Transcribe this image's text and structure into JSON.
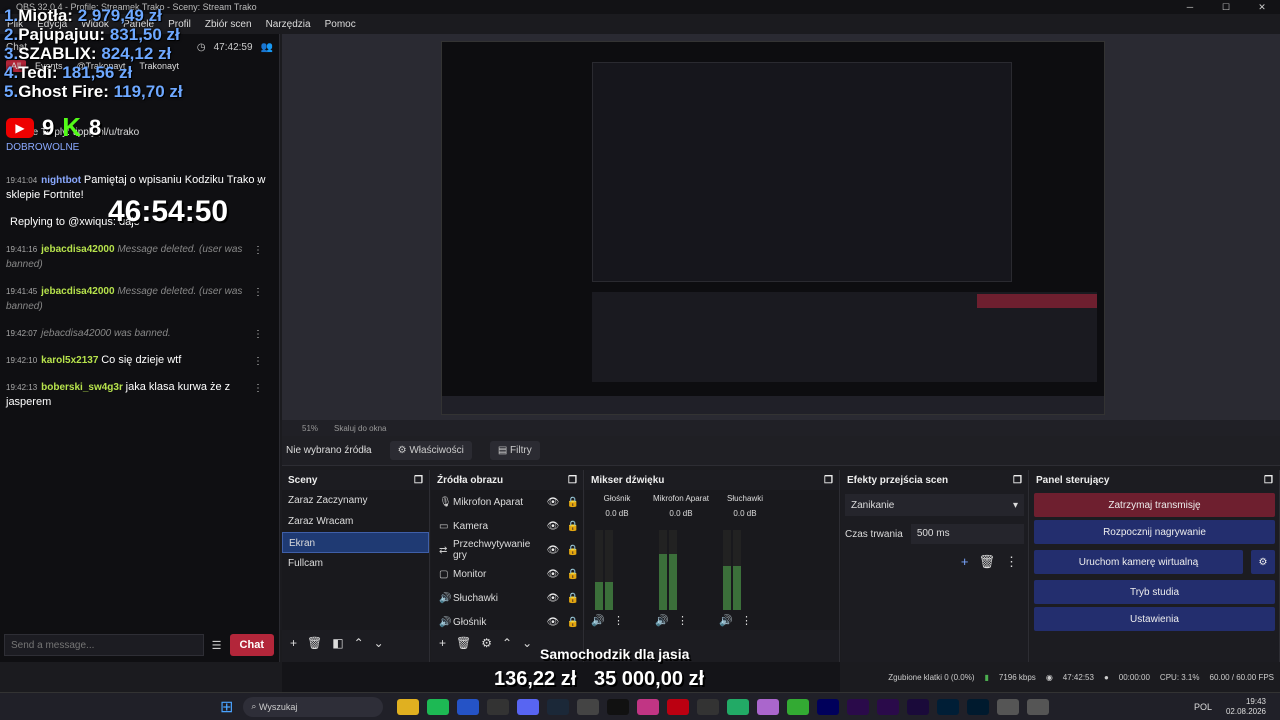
{
  "window": {
    "title": "OBS 32.0.4 - Profile: Streamek Trako - Sceny: Stream Trako",
    "controls": [
      "─",
      "☐",
      "✕"
    ]
  },
  "menu": [
    "Plik",
    "Edycja",
    "Widok",
    "Panele",
    "Profil",
    "Zbiór scen",
    "Narzędzia",
    "Pomoc"
  ],
  "overlay": {
    "donors": [
      {
        "num": "1.",
        "name": "Miotła:",
        "amount": "2 979,49 zł"
      },
      {
        "num": "2.",
        "name": "Pajupajuu:",
        "amount": "831,50 zł"
      },
      {
        "num": "3.",
        "name": "SZABLIX:",
        "amount": "824,12 zł"
      },
      {
        "num": "4.",
        "name": "Tedi:",
        "amount": "181,56 zł"
      },
      {
        "num": "5.",
        "name": "Ghost Fire:",
        "amount": "119,70 zł"
      }
    ],
    "yt_count": "9",
    "kick_count": "8",
    "timer": "46:54:50",
    "bottom_title": "Samochodzik dla jasia",
    "bottom_money_1": "136,22 zł",
    "bottom_money_2": "35 000,00 zł"
  },
  "chat": {
    "header_label": "Chat",
    "clock": "47:42:59",
    "tabs": [
      "All",
      "Events",
      "@Trakonayt",
      "Trakonayt"
    ],
    "donate_line": "Donate Tipply: tipply.pl/u/trako",
    "donate_line2": "DOBROWOLNE",
    "messages": [
      {
        "time": "19:41:04",
        "user": "nightbot",
        "text": "Pamiętaj o wpisaniu Kodziku Trako w sklepie Fortnite!",
        "type": "blue"
      },
      {
        "time": "",
        "user": "",
        "text": "Replying to @xwiqus: daje",
        "type": "reply"
      },
      {
        "time": "19:41:16",
        "user": "jebacdisa42000",
        "text": "Message deleted. (user was banned)",
        "type": "deleted"
      },
      {
        "time": "19:41:45",
        "user": "jebacdisa42000",
        "text": "Message deleted. (user was banned)",
        "type": "deleted"
      },
      {
        "time": "19:42:07",
        "user": "",
        "text": "jebacdisa42000 was banned.",
        "type": "ban"
      },
      {
        "time": "19:42:10",
        "user": "karol5x2137",
        "text": "Co się dzieje wtf",
        "type": "white"
      },
      {
        "time": "19:42:13",
        "user": "boberski_sw4g3r",
        "text": "jaka klasa kurwa że z jasperem",
        "type": "green"
      }
    ],
    "input_placeholder": "Send a message...",
    "send_label": "Chat"
  },
  "preview": {
    "zoom": "51%",
    "fit_label": "Skaluj do okna"
  },
  "source_bar": {
    "label": "Nie wybrano źródła",
    "props": "Właściwości",
    "filters": "Filtry"
  },
  "scenes": {
    "title": "Sceny",
    "items": [
      "Zaraz Zaczynamy",
      "Zaraz Wracam",
      "Ekran",
      "Fullcam"
    ],
    "selected": 2
  },
  "sources": {
    "title": "Źródła obrazu",
    "items": [
      {
        "icon": "microphone-icon",
        "glyph": "🎙",
        "name": "Mikrofon Aparat"
      },
      {
        "icon": "camera-icon",
        "glyph": "▭",
        "name": "Kamera"
      },
      {
        "icon": "capture-icon",
        "glyph": "⇄",
        "name": "Przechwytywanie gry"
      },
      {
        "icon": "monitor-icon",
        "glyph": "▢",
        "name": "Monitor"
      },
      {
        "icon": "speaker-icon",
        "glyph": "🔊",
        "name": "Słuchawki"
      },
      {
        "icon": "speaker-icon",
        "glyph": "🔊",
        "name": "Głośnik"
      }
    ]
  },
  "mixer": {
    "title": "Mikser dźwięku",
    "channels": [
      {
        "name": "Głośnik",
        "db": "0.0 dB",
        "level": 0.35
      },
      {
        "name": "Mikrofon Aparat",
        "db": "0.0 dB",
        "level": 0.7
      },
      {
        "name": "Słuchawki",
        "db": "0.0 dB",
        "level": 0.55
      }
    ],
    "scale": [
      "0",
      "-5",
      "-10",
      "-15",
      "-20",
      "-25",
      "-30",
      "-35",
      "-40",
      "-45",
      "-50",
      "-55",
      "-60"
    ]
  },
  "transitions": {
    "title": "Efekty przejścia scen",
    "selected": "Zanikanie",
    "duration_label": "Czas trwania",
    "duration": "500 ms"
  },
  "controls": {
    "title": "Panel sterujący",
    "buttons": [
      "Zatrzymaj transmisję",
      "Rozpocznij nagrywanie",
      "Uruchom kamerę wirtualną",
      "Tryb studia",
      "Ustawienia"
    ]
  },
  "status": {
    "dropped": "Zgubione klatki 0 (0.0%)",
    "bitrate": "7196 kbps",
    "stream_time": "47:42:53",
    "rec_time": "00:00:00",
    "cpu": "CPU: 3.1%",
    "fps": "60.00 / 60.00 FPS"
  },
  "taskbar": {
    "search": "Wyszukaj",
    "lang": "POL",
    "time": "19:43",
    "date": "02.08.2026"
  }
}
